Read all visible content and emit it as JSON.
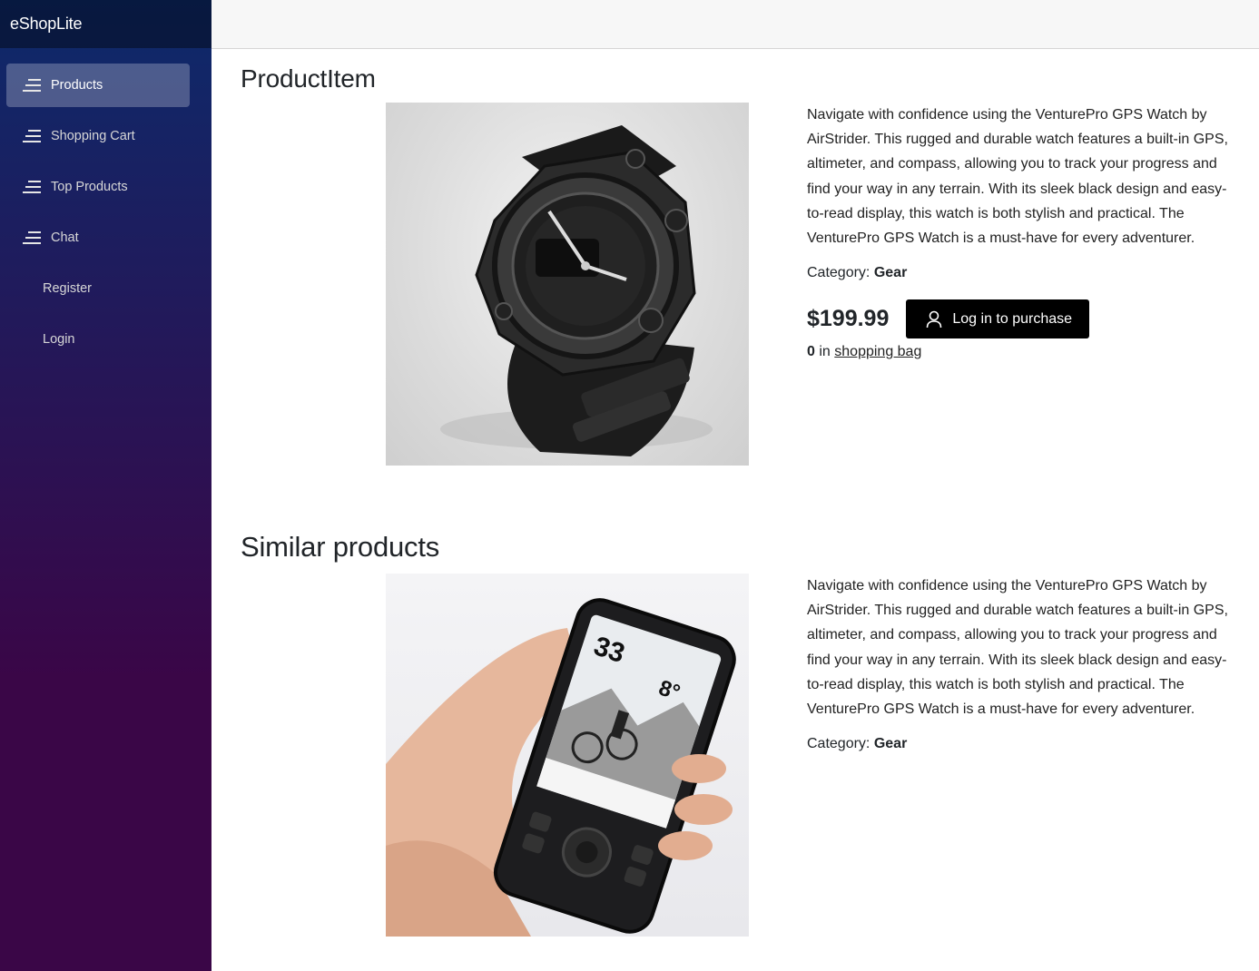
{
  "app": {
    "brand": "eShopLite"
  },
  "sidebar": {
    "items": [
      {
        "label": "Products",
        "icon": "menu-lines-icon",
        "active": true
      },
      {
        "label": "Shopping Cart",
        "icon": "menu-lines-icon"
      },
      {
        "label": "Top Products",
        "icon": "menu-lines-icon"
      },
      {
        "label": "Chat",
        "icon": "menu-lines-icon"
      },
      {
        "label": "Register"
      },
      {
        "label": "Login"
      }
    ]
  },
  "product": {
    "heading": "ProductItem",
    "image_icon": "gps-watch-photo",
    "description": "Navigate with confidence using the VenturePro GPS Watch by AirStrider. This rugged and durable watch features a built-in GPS, altimeter, and compass, allowing you to track your progress and find your way in any terrain. With its sleek black design and easy-to-read display, this watch is both stylish and practical. The VenturePro GPS Watch is a must-have for every adventurer.",
    "category_label": "Category:",
    "category": "Gear",
    "price": "$199.99",
    "purchase_button": "Log in to purchase",
    "bag_count": "0",
    "bag_in": "in",
    "bag_link": "shopping bag"
  },
  "similar": {
    "heading": "Similar products",
    "items": [
      {
        "image_icon": "handheld-gps-photo",
        "description": "Navigate with confidence using the VenturePro GPS Watch by AirStrider. This rugged and durable watch features a built-in GPS, altimeter, and compass, allowing you to track your progress and find your way in any terrain. With its sleek black design and easy-to-read display, this watch is both stylish and practical. The VenturePro GPS Watch is a must-have for every adventurer.",
        "category_label": "Category:",
        "category": "Gear"
      }
    ]
  },
  "colors": {
    "sidebar_top": "#0d2a6b",
    "sidebar_bottom": "#3a0647",
    "button_bg": "#000000"
  }
}
